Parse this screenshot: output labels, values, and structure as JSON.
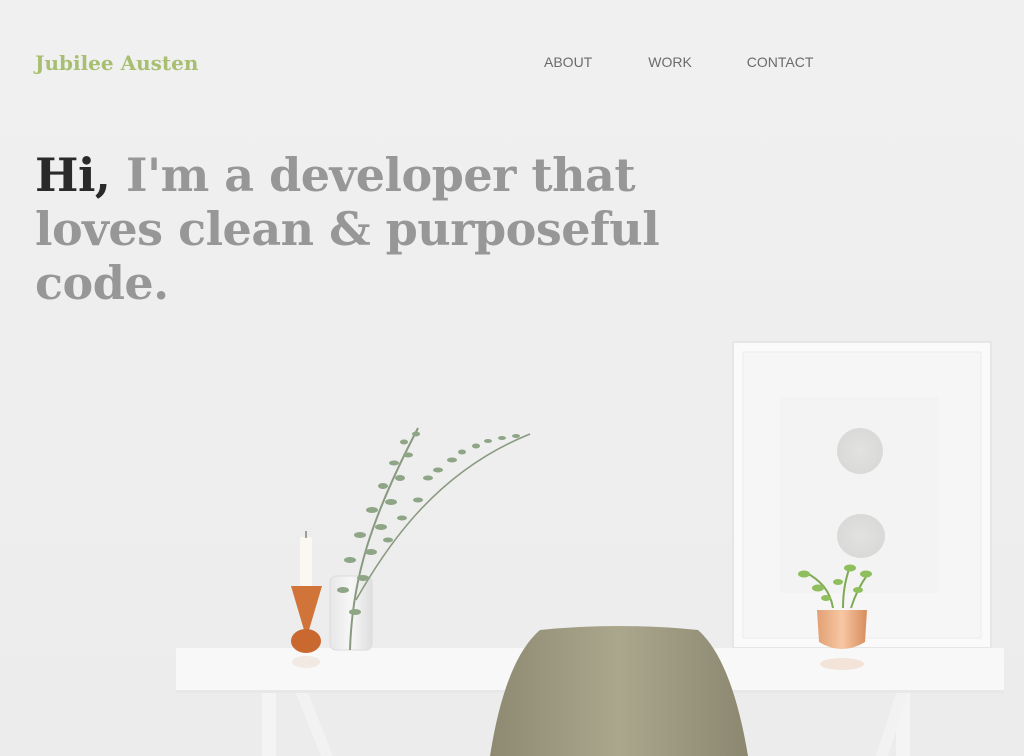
{
  "header": {
    "brand": "Jubilee Austen",
    "nav": [
      {
        "label": "ABOUT"
      },
      {
        "label": "WORK"
      },
      {
        "label": "CONTACT"
      }
    ]
  },
  "hero": {
    "greeting": "Hi,",
    "line1_rest": "I'm a developer that",
    "line2": "loves clean & purposeful",
    "line3": "code."
  },
  "colors": {
    "brand": "#a8bf72",
    "heading_dark": "#2a2a2a",
    "heading_muted": "#979797",
    "nav_text": "#6b6b6b",
    "background": "#f0f0f0"
  },
  "icons": {
    "background_scene": "desk-scene-illustration"
  }
}
